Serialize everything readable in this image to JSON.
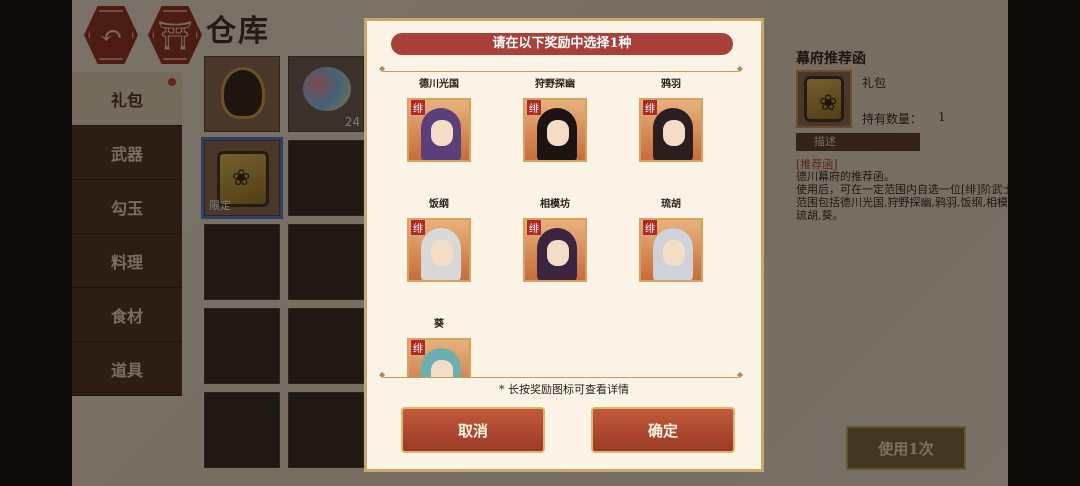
{
  "header": {
    "title": "仓库",
    "back_icon": "back-arrow-icon",
    "home_icon": "shrine-icon"
  },
  "tabs": [
    {
      "label": "礼包",
      "active": true,
      "has_notice": true
    },
    {
      "label": "武器",
      "active": false
    },
    {
      "label": "勾玉",
      "active": false
    },
    {
      "label": "料理",
      "active": false
    },
    {
      "label": "食材",
      "active": false
    },
    {
      "label": "道具",
      "active": false
    }
  ],
  "inventory": {
    "slots": [
      {
        "kind": "bundle-pouch",
        "qty": ""
      },
      {
        "kind": "tricolor-orb",
        "qty": "24"
      },
      {
        "kind": "recommend-letter",
        "qty": "",
        "tag": "限定",
        "selected": true
      }
    ]
  },
  "detail": {
    "name": "幕府推荐函",
    "type": "礼包",
    "count_label": "持有数量：",
    "count_value": "1",
    "desc_header": "描述",
    "desc_tag": "[推荐函]",
    "desc_text": "德川幕府的推荐函。\n使用后，可在一定范围内自选一位[绯]阶武士，范围包括德川光国,狩野探幽,鸦羽,饭纲,相模坊,琉胡,葵。",
    "use_button": "使用1次"
  },
  "modal": {
    "title": "请在以下奖励中选择1种",
    "rewards": [
      {
        "name": "德川光国",
        "rank": "绯",
        "hair": "#5a3f7a"
      },
      {
        "name": "狩野探幽",
        "rank": "绯",
        "hair": "#1c1414"
      },
      {
        "name": "鸦羽",
        "rank": "绯",
        "hair": "#2a1e1e"
      },
      {
        "name": "饭纲",
        "rank": "绯",
        "hair": "#d8d8d8"
      },
      {
        "name": "相模坊",
        "rank": "绯",
        "hair": "#3a2440"
      },
      {
        "name": "琉胡",
        "rank": "绯",
        "hair": "#cfd2d8"
      },
      {
        "name": "葵",
        "rank": "绯",
        "hair": "#6ab0b0"
      }
    ],
    "hint": "* 长按奖励图标可查看详情",
    "cancel_label": "取消",
    "confirm_label": "确定"
  },
  "colors": {
    "accent_red": "#a9413a",
    "gold": "#caa56d",
    "selection": "#4e7cd6"
  }
}
